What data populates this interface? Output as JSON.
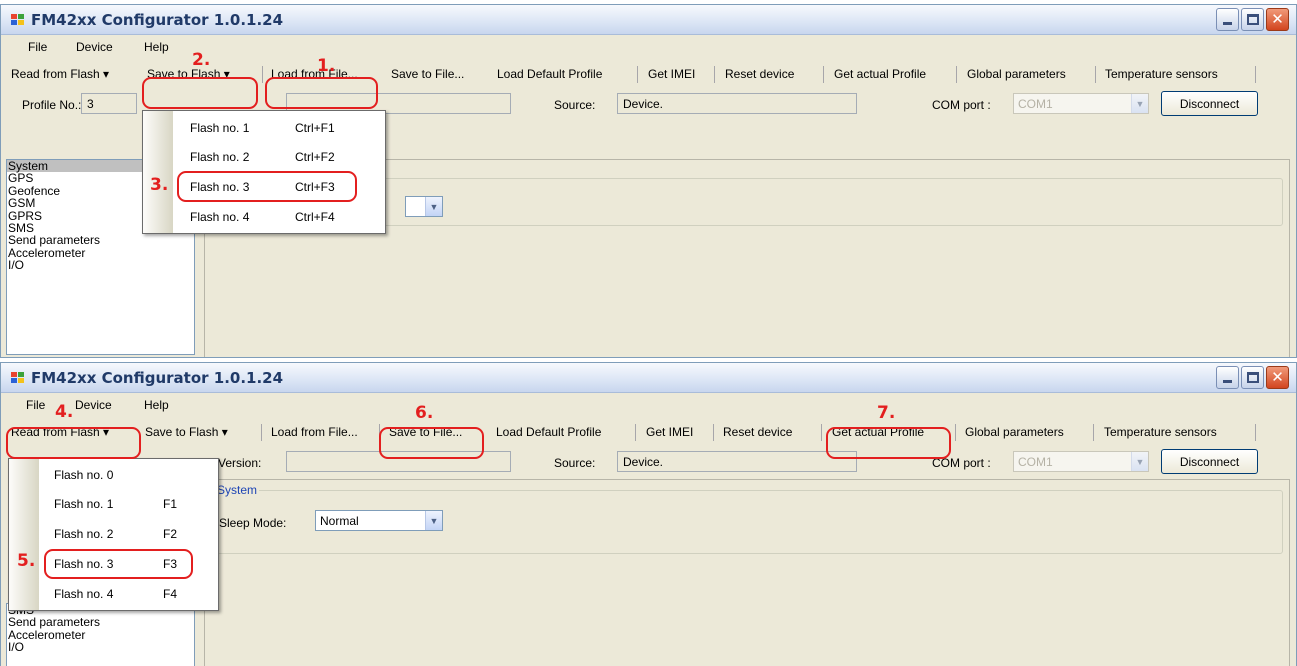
{
  "app": {
    "title": "FM42xx Configurator 1.0.1.24",
    "window_buttons": [
      "minimize-icon",
      "maximize-icon",
      "close-icon"
    ]
  },
  "menu": [
    "File",
    "Device",
    "Help"
  ],
  "toolbar": {
    "read_from_flash": "Read from Flash",
    "save_to_flash": "Save to Flash",
    "dropdown_arrow": "▾",
    "load_from_file": "Load from File...",
    "save_to_file": "Save to File...",
    "load_default_profile": "Load Default Profile",
    "get_imei": "Get IMEI",
    "reset_device": "Reset device",
    "get_actual_profile": "Get actual Profile",
    "global_parameters": "Global parameters",
    "temperature_sensors": "Temperature sensors"
  },
  "infobar": {
    "profile_label": "Profile No.:",
    "profile_value": "3",
    "version_label": "Version:",
    "source_label": "Source:",
    "source_value": "Device.",
    "com_port_label": "COM port :",
    "com_port_value": "COM1",
    "disconnect": "Disconnect"
  },
  "sidebar": {
    "items": [
      "System",
      "GPS",
      "Geofence",
      "GSM",
      "GPRS",
      "SMS",
      "Send parameters",
      "Accelerometer",
      "I/O"
    ],
    "selected": "System"
  },
  "system_group": {
    "title": "System",
    "sleep_mode_label": "Sleep Mode:",
    "sleep_mode_value": "Normal"
  },
  "save_menu": [
    {
      "label": "Flash no. 1",
      "shortcut": "Ctrl+F1"
    },
    {
      "label": "Flash no. 2",
      "shortcut": "Ctrl+F2"
    },
    {
      "label": "Flash no. 3",
      "shortcut": "Ctrl+F3"
    },
    {
      "label": "Flash no. 4",
      "shortcut": "Ctrl+F4"
    }
  ],
  "read_menu": [
    {
      "label": "Flash no. 0",
      "shortcut": ""
    },
    {
      "label": "Flash no. 1",
      "shortcut": "F1"
    },
    {
      "label": "Flash no. 2",
      "shortcut": "F2"
    },
    {
      "label": "Flash no. 3",
      "shortcut": "F3"
    },
    {
      "label": "Flash no. 4",
      "shortcut": "F4"
    }
  ],
  "annotations": [
    "1.",
    "2.",
    "3.",
    "4.",
    "5.",
    "6.",
    "7."
  ],
  "colors": {
    "annotation": "#e31f1f",
    "group_title": "#1e45b5",
    "window_bg": "#ece9d8"
  }
}
